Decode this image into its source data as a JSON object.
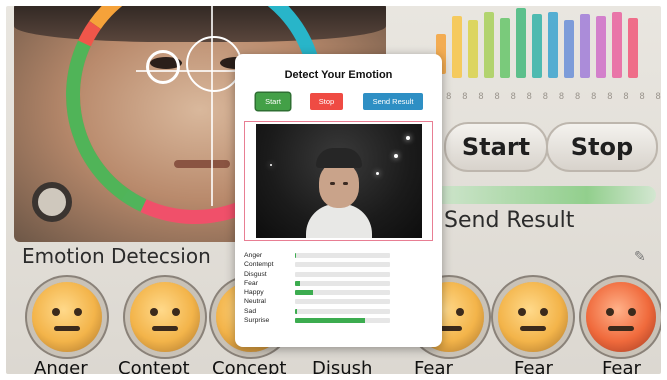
{
  "modal": {
    "title": "Detect Your Emotion",
    "buttons": {
      "start": "Start",
      "stop": "Stop",
      "send": "Send Result"
    },
    "colors": {
      "start": "#43a047",
      "stop": "#ef4b43",
      "send": "#2e8fc4",
      "bar": "#3cac4f",
      "frame": "#e87e93"
    }
  },
  "emotions": [
    {
      "label": "Anger",
      "value": 0.01
    },
    {
      "label": "Contempt",
      "value": 0.0
    },
    {
      "label": "Disgust",
      "value": 0.0
    },
    {
      "label": "Fear",
      "value": 0.05
    },
    {
      "label": "Happy",
      "value": 0.19
    },
    {
      "label": "Neutral",
      "value": 0.0
    },
    {
      "label": "Sad",
      "value": 0.02
    },
    {
      "label": "Surprise",
      "value": 0.74
    }
  ],
  "background": {
    "title": "Emotion Detecsion",
    "start": "Start",
    "stop": "Stop",
    "send": "Send Result",
    "emoji_labels": [
      "Anger",
      "Contept",
      "Concept",
      "Disush",
      "Fear",
      "Fear",
      "Fear"
    ],
    "eq_ticks": [
      "8",
      "8",
      "8",
      "8",
      "8",
      "8",
      "8",
      "8",
      "8",
      "8",
      "8",
      "8",
      "8",
      "8"
    ]
  }
}
